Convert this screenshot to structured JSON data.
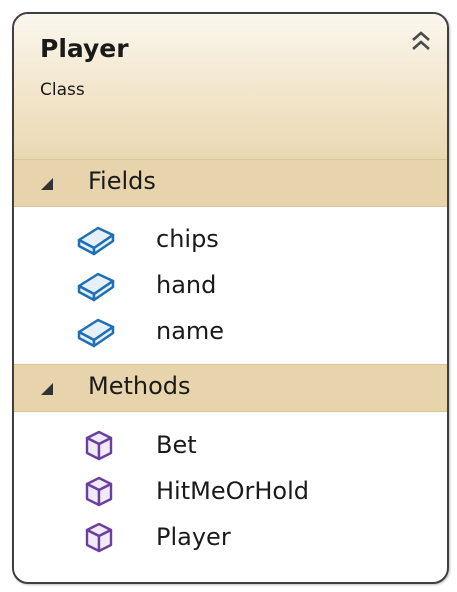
{
  "class": {
    "name": "Player",
    "stereotype": "Class",
    "collapse_icon": "double-chevron-up-icon"
  },
  "sections": {
    "fields": {
      "label": "Fields",
      "icon": "collapse-triangle-icon",
      "items": [
        {
          "label": "chips",
          "icon": "field-icon"
        },
        {
          "label": "hand",
          "icon": "field-icon"
        },
        {
          "label": "name",
          "icon": "field-icon"
        }
      ]
    },
    "methods": {
      "label": "Methods",
      "icon": "collapse-triangle-icon",
      "items": [
        {
          "label": "Bet",
          "icon": "method-icon"
        },
        {
          "label": "HitMeOrHold",
          "icon": "method-icon"
        },
        {
          "label": "Player",
          "icon": "method-icon"
        }
      ]
    }
  },
  "colors": {
    "header_gradient_top": "#fbf7ee",
    "header_gradient_bottom": "#ead8b2",
    "section_header": "#e7d4ac",
    "field_icon": "#1f6fb5",
    "method_icon": "#6b3fa0",
    "border": "#3f3f3f"
  }
}
